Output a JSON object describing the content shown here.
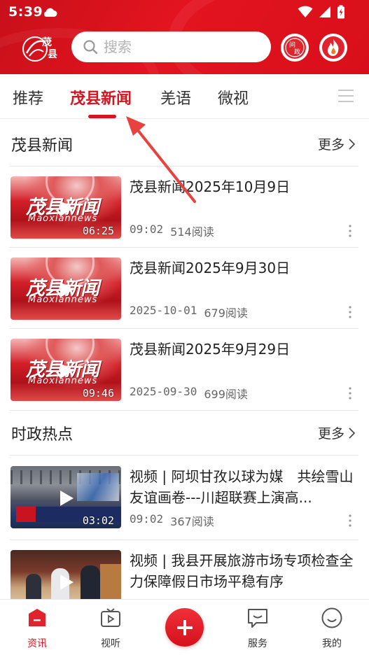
{
  "status": {
    "time": "5:39"
  },
  "header": {
    "logo_text": "茂县",
    "search_placeholder": "搜索",
    "ask_badge_text": "问政"
  },
  "tabs": [
    {
      "label": "推荐",
      "active": false
    },
    {
      "label": "茂县新闻",
      "active": true
    },
    {
      "label": "羌语",
      "active": false
    },
    {
      "label": "微视",
      "active": false
    }
  ],
  "sections": [
    {
      "title": "茂县新闻",
      "more_label": "更多",
      "items": [
        {
          "title": "茂县新闻2025年10月9日",
          "time": "09:02",
          "reads": "514阅读",
          "duration": "06:25",
          "thumb": "news"
        },
        {
          "title": "茂县新闻2025年9月30日",
          "time": "2025-10-01",
          "reads": "679阅读",
          "duration": "",
          "thumb": "news"
        },
        {
          "title": "茂县新闻2025年9月29日",
          "time": "2025-09-30",
          "reads": "699阅读",
          "duration": "09:46",
          "thumb": "news"
        }
      ]
    },
    {
      "title": "时政热点",
      "more_label": "更多",
      "items": [
        {
          "title": "视频 | 阿坝甘孜以球为媒　共绘雪山友谊画卷---川超联赛上演高...",
          "time": "09:02",
          "reads": "367阅读",
          "duration": "03:02",
          "thumb": "photo-football"
        },
        {
          "title": "视频 | 我县开展旅游市场专项检查全力保障假日市场平稳有序",
          "time": "",
          "reads": "",
          "duration": "",
          "thumb": "photo-market"
        }
      ]
    }
  ],
  "thumb_branding": {
    "brand_cn": "茂县新闻",
    "brand_en": "Maoxiannews"
  },
  "bottom_nav": [
    {
      "label": "资讯",
      "icon": "news-icon",
      "active": true
    },
    {
      "label": "视听",
      "icon": "tv-icon",
      "active": false
    },
    {
      "label": "",
      "icon": "plus-icon",
      "active": false
    },
    {
      "label": "服务",
      "icon": "chat-icon",
      "active": false
    },
    {
      "label": "我的",
      "icon": "smile-icon",
      "active": false
    }
  ],
  "colors": {
    "brand_red": "#d7141f",
    "header_red": "#e3141f"
  }
}
